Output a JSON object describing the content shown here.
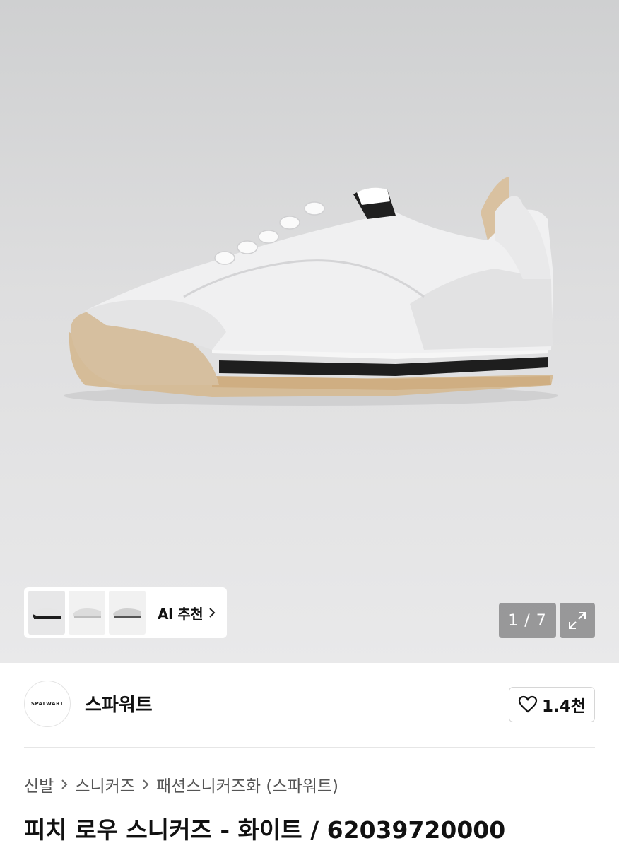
{
  "gallery": {
    "thumbnails": [
      {
        "icon": "shoe-black-sole-thumbnail"
      },
      {
        "icon": "shoe-white-thumbnail"
      },
      {
        "icon": "shoe-grey-thumbnail"
      }
    ],
    "ai_recommend_label": "AI 추천",
    "counter": "1 / 7",
    "expand_icon": "expand-icon"
  },
  "store": {
    "logo_text": "SPALWART",
    "name": "스파워트",
    "like_count": "1.4천"
  },
  "breadcrumb": {
    "items": [
      "신발",
      "스니커즈",
      "패션스니커즈화 (스파워트)"
    ]
  },
  "product": {
    "title": "피치 로우 스니커즈 - 화이트 / 62039720000"
  },
  "colors": {
    "hero_bg": "#dcdcdd",
    "sole_gum": "#d3b996",
    "sole_stripe": "#1c1c1c"
  }
}
